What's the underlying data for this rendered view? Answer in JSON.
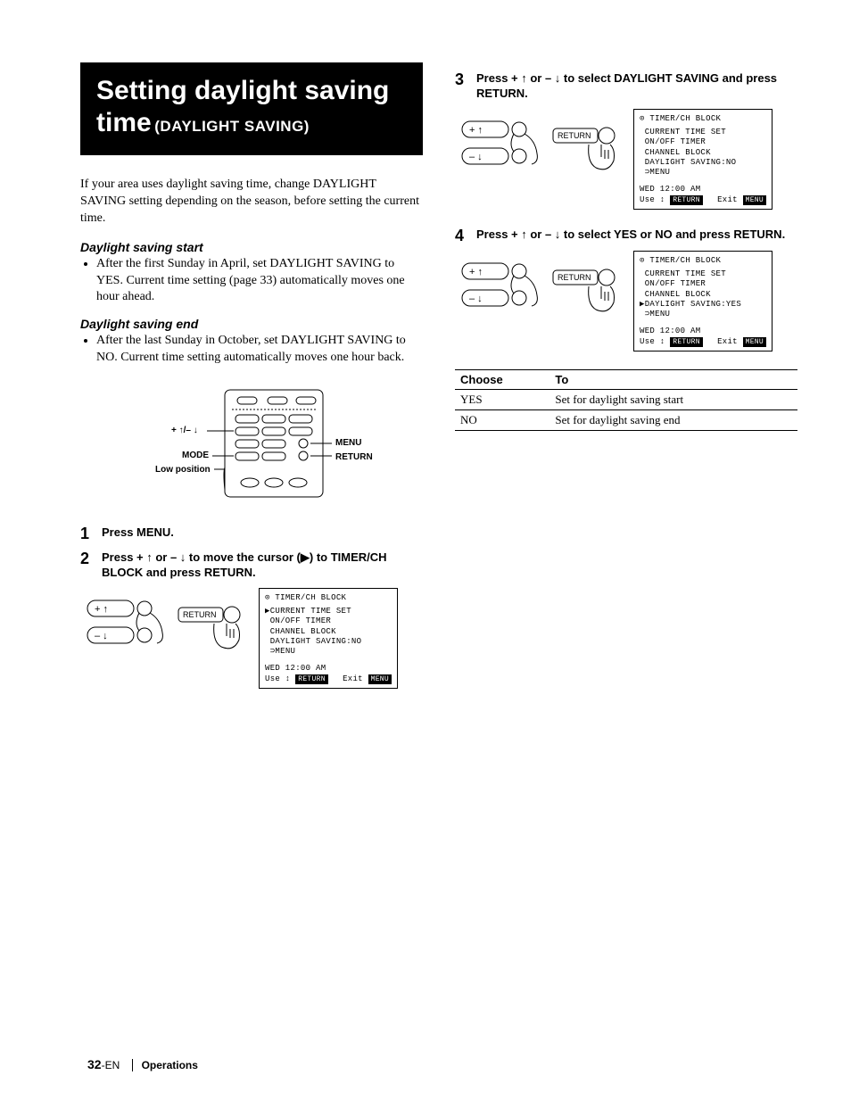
{
  "title": {
    "main": "Setting daylight saving time",
    "sub": "(DAYLIGHT SAVING)"
  },
  "intro": "If your area uses daylight saving time, change DAYLIGHT SAVING setting depending on the season, before setting the current time.",
  "ds_start": {
    "heading": "Daylight saving start",
    "bullet": "After the first Sunday in April, set DAYLIGHT SAVING to YES.  Current time setting (page 33) automatically moves one hour ahead."
  },
  "ds_end": {
    "heading": "Daylight saving end",
    "bullet": "After the last Sunday in October, set DAYLIGHT SAVING to NO.  Current time setting automatically moves one hour back."
  },
  "remote_labels": {
    "plusminus": "+ ↑/– ↓",
    "mode": "MODE",
    "low": "Low position",
    "menu": "MENU",
    "ret": "RETURN"
  },
  "steps": {
    "s1": "Press MENU.",
    "s2": "Press + ↑ or – ↓ to move the cursor (▶) to TIMER/CH BLOCK and press RETURN.",
    "s3": "Press + ↑ or – ↓ to select DAYLIGHT SAVING and press RETURN.",
    "s4": "Press + ↑ or – ↓ to select YES or NO and press RETURN."
  },
  "buttons": {
    "plus": "+ ↑",
    "minus": "– ↓",
    "ret": "RETURN"
  },
  "osd": {
    "title": "⊙ TIMER/CH BLOCK",
    "items": {
      "current": "CURRENT TIME SET",
      "onoff": "ON/OFF TIMER",
      "chblock": "CHANNEL BLOCK",
      "ds_no": "DAYLIGHT SAVING:NO",
      "ds_yes": "DAYLIGHT SAVING:YES",
      "menu": "⊃MENU"
    },
    "bottom_time": "WED 12:00 AM",
    "use": "Use ↕",
    "ret_box": "RETURN",
    "exit": "Exit",
    "menu_box": "MENU"
  },
  "table": {
    "h1": "Choose",
    "h2": "To",
    "r1c1": "YES",
    "r1c2": "Set for daylight saving start",
    "r2c1": "NO",
    "r2c2": "Set for daylight saving end"
  },
  "footer": {
    "page": "32",
    "suffix": "-EN",
    "section": "Operations"
  }
}
